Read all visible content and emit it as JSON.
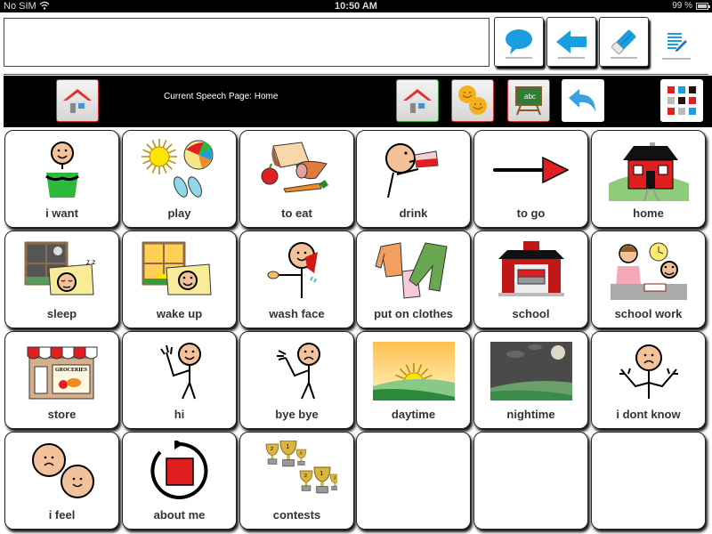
{
  "status_bar": {
    "carrier": "No SIM",
    "time": "10:50 AM",
    "battery_percent": "99 %",
    "battery_level": 0.99
  },
  "top_bar": {
    "message_text": "",
    "buttons": [
      {
        "name": "speak",
        "icon": "speech-bubble-icon"
      },
      {
        "name": "backspace",
        "icon": "left-arrow-icon"
      },
      {
        "name": "clear",
        "icon": "eraser-icon"
      },
      {
        "name": "edit",
        "icon": "notepad-pencil-icon"
      }
    ]
  },
  "nav_bar": {
    "current_page_label": "Current Speech Page: Home",
    "buttons": [
      {
        "name": "home-left",
        "icon": "house-icon"
      },
      {
        "name": "home",
        "icon": "house-icon"
      },
      {
        "name": "feelings",
        "icon": "smiley-faces-icon"
      },
      {
        "name": "school",
        "icon": "chalkboard-icon"
      },
      {
        "name": "back",
        "icon": "back-arrow-icon"
      },
      {
        "name": "color-grid",
        "icon": "color-grid-icon"
      }
    ]
  },
  "grid": {
    "columns": 6,
    "rows": 4,
    "cells": [
      {
        "label": "i want",
        "icon": "i-want-icon"
      },
      {
        "label": "play",
        "icon": "play-icon"
      },
      {
        "label": "to eat",
        "icon": "food-icon"
      },
      {
        "label": "drink",
        "icon": "drink-icon"
      },
      {
        "label": "to go",
        "icon": "arrow-right-icon"
      },
      {
        "label": "home",
        "icon": "house-icon"
      },
      {
        "label": "sleep",
        "icon": "sleep-icon"
      },
      {
        "label": "wake up",
        "icon": "wake-up-icon"
      },
      {
        "label": "wash face",
        "icon": "wash-face-icon"
      },
      {
        "label": "put on clothes",
        "icon": "clothes-icon"
      },
      {
        "label": "school",
        "icon": "school-icon"
      },
      {
        "label": "school work",
        "icon": "school-work-icon"
      },
      {
        "label": "store",
        "icon": "store-icon"
      },
      {
        "label": "hi",
        "icon": "wave-hi-icon"
      },
      {
        "label": "bye bye",
        "icon": "wave-bye-icon"
      },
      {
        "label": "daytime",
        "icon": "sunrise-icon"
      },
      {
        "label": "nightime",
        "icon": "night-moon-icon"
      },
      {
        "label": "i dont know",
        "icon": "shrug-icon"
      },
      {
        "label": "i feel",
        "icon": "feelings-faces-icon"
      },
      {
        "label": "about me",
        "icon": "about-me-icon"
      },
      {
        "label": "contests",
        "icon": "trophies-icon"
      },
      {
        "label": "",
        "icon": ""
      },
      {
        "label": "",
        "icon": ""
      },
      {
        "label": "",
        "icon": ""
      }
    ]
  },
  "colors": {
    "accent_blue": "#1a9ee0",
    "symbol_red": "#e02020",
    "nav_background": "#000000"
  }
}
